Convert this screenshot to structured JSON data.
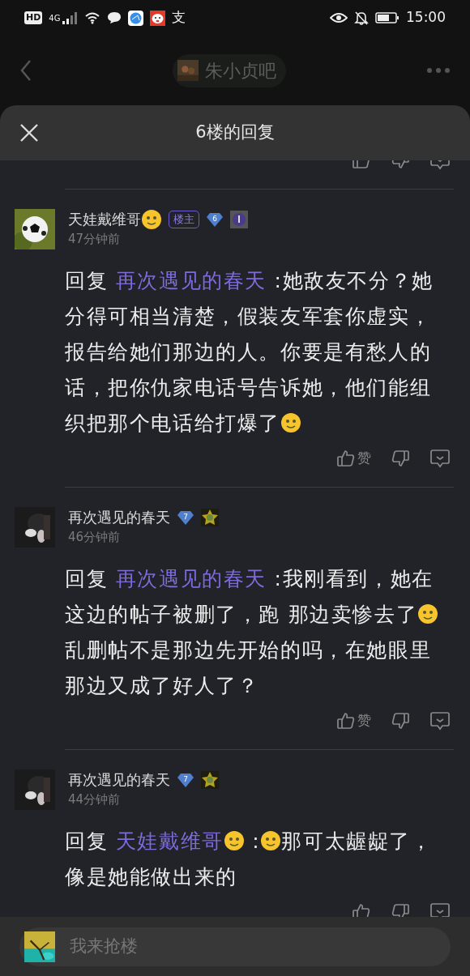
{
  "status_bar": {
    "hd": "HD",
    "network": "4G",
    "app_glyph": "支",
    "time": "15:00"
  },
  "top_nav": {
    "forum_name": "朱小贞吧"
  },
  "sheet": {
    "title": "6楼的回复"
  },
  "replies": [
    {
      "kind": "actions_only"
    },
    {
      "kind": "comment",
      "author": "天娃戴维哥",
      "author_emoji": true,
      "badge": "楼主",
      "rank": "6",
      "time": "47分钟前",
      "like_label": "赞",
      "body": [
        {
          "kind": "text",
          "text": "回复 "
        },
        {
          "kind": "mention",
          "text": "再次遇见的春天"
        },
        {
          "kind": "text",
          "text": " :她敌友不分？她分得可相当清楚，假装友军套你虚实，报告给她们那边的人。你要是有愁人的话，把你仇家电话号告诉她，他们能组织把那个电话给打爆了"
        },
        {
          "kind": "emoji"
        }
      ]
    },
    {
      "kind": "comment",
      "author": "再次遇见的春天",
      "rank": "7",
      "time": "46分钟前",
      "like_label": "赞",
      "body": [
        {
          "kind": "text",
          "text": "回复 "
        },
        {
          "kind": "mention",
          "text": "再次遇见的春天"
        },
        {
          "kind": "text",
          "text": " :我刚看到，她在这边的帖子被删了，跑 那边卖惨去了"
        },
        {
          "kind": "emoji"
        },
        {
          "kind": "text",
          "text": "乱删帖不是那边先开始的吗，在她眼里那边又成了好人了？"
        }
      ]
    },
    {
      "kind": "comment",
      "author": "再次遇见的春天",
      "rank": "7",
      "time": "44分钟前",
      "body": [
        {
          "kind": "text",
          "text": "回复 "
        },
        {
          "kind": "mention",
          "text": "天娃戴维哥"
        },
        {
          "kind": "emoji"
        },
        {
          "kind": "text",
          "text": " :"
        },
        {
          "kind": "emoji"
        },
        {
          "kind": "text",
          "text": "那可太龌龊了，像是她能做出来的"
        }
      ]
    }
  ],
  "composer": {
    "placeholder": "我来抢楼"
  }
}
